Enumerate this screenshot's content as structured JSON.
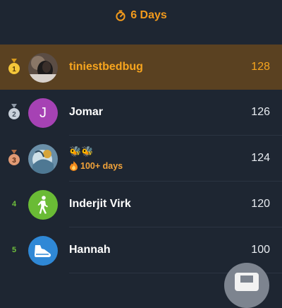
{
  "header": {
    "title": "6 Days",
    "icon": "timer-icon",
    "accent": "#f29a1c"
  },
  "leaderboard": [
    {
      "rank": "1",
      "medal": "gold",
      "name": "tiniestbedbug",
      "score": "128",
      "highlight": true,
      "avatar": "photo"
    },
    {
      "rank": "2",
      "medal": "silver",
      "name": "Jomar",
      "score": "126",
      "avatar_letter": "J",
      "avatar_color": "#a642b4"
    },
    {
      "rank": "3",
      "medal": "bronze",
      "name": "",
      "streak_emojis": "🐝🐝",
      "streak_label": "100+ days",
      "score": "124",
      "avatar": "painting"
    },
    {
      "rank": "4",
      "name": "Inderjit Virk",
      "score": "120",
      "avatar": "walking-person",
      "avatar_color": "#6abb35"
    },
    {
      "rank": "5",
      "name": "Hannah",
      "score": "100",
      "avatar": "shoe",
      "avatar_color": "#2f88d6"
    }
  ],
  "fab": {
    "icon": "store-icon"
  }
}
